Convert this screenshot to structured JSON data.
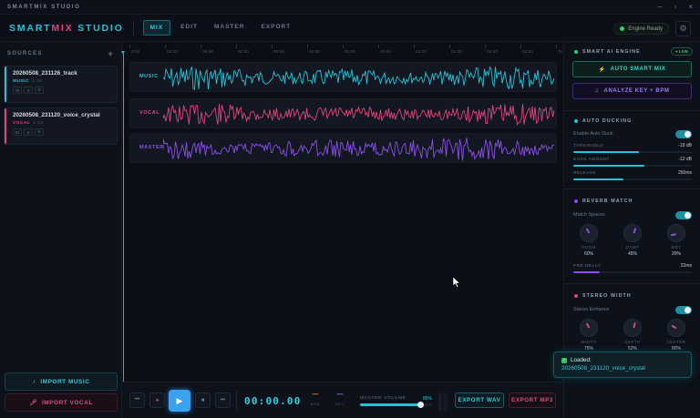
{
  "titlebar": {
    "title": "SMARTMIX STUDIO",
    "min": "–",
    "max": "▫",
    "close": "×"
  },
  "header": {
    "logo_a": "SMART",
    "logo_b": "MIX",
    "logo_c": " STUDIO",
    "tabs": [
      {
        "label": "MIX",
        "active": true
      },
      {
        "label": "EDIT"
      },
      {
        "label": "MASTER"
      },
      {
        "label": "EXPORT"
      }
    ],
    "engine_status": "Engine Ready",
    "settings_icon": "gear-icon"
  },
  "sources": {
    "title": "SOURCES",
    "add": "+",
    "items": [
      {
        "name": "20260508_231126_track",
        "type": "MUSIC",
        "duration": "1:16",
        "color": "#22c5d6",
        "buttons": [
          "M",
          "S",
          "⊘"
        ]
      },
      {
        "name": "20260508_231120_voice_crystal",
        "type": "VOCAL",
        "duration": "1:16",
        "color": "#e0447f",
        "buttons": [
          "M",
          "S",
          "⊘"
        ]
      }
    ],
    "import_music": "IMPORT MUSIC",
    "import_vocal": "IMPORT VOCAL"
  },
  "timeline": {
    "ruler": [
      "0:00",
      "00:10",
      "00:20",
      "00:30",
      "00:40",
      "00:50",
      "01:00",
      "01:10",
      "01:20",
      "01:30",
      "01:40",
      "01:50",
      "01:5"
    ],
    "lanes": [
      {
        "label": "MUSIC",
        "color": "#22c5d6"
      },
      {
        "label": "VOCAL",
        "color": "#e0447f"
      },
      {
        "label": "MASTER",
        "color": "#8a4fe6"
      }
    ]
  },
  "transport": {
    "timecode": "00:00.00",
    "bpm_value": "—",
    "bpm_label": "BPM",
    "key_value": "—",
    "key_label": "KEY",
    "master_volume_label": "MASTER VOLUME",
    "master_volume_pct": "85%",
    "master_volume": 0.85,
    "export_wav": "EXPORT WAV",
    "export_mp3": "EXPORT MP3"
  },
  "ai_engine": {
    "title": "SMART AI ENGINE",
    "live": "● LIVE",
    "auto_button": "AUTO SMART MIX",
    "analyze_button": "ANALYZE KEY + BPM"
  },
  "ducking": {
    "title": "AUTO DUCKING",
    "enable_label": "Enable Auto Duck",
    "enabled": true,
    "threshold_label": "THRESHOLD",
    "threshold_value": "-18 dB",
    "threshold_level": 0.55,
    "amount_label": "DUCK AMOUNT",
    "amount_value": "-12 dB",
    "amount_level": 0.6,
    "release_label": "RELEASE",
    "release_value": "250ms",
    "release_level": 0.42
  },
  "reverb": {
    "title": "REVERB MATCH",
    "match_label": "Match Spaces",
    "enabled": true,
    "knobs": [
      {
        "label": "ROOM",
        "value": "60%"
      },
      {
        "label": "DAMP",
        "value": "45%"
      },
      {
        "label": "WET",
        "value": "20%"
      }
    ],
    "predelay_label": "PRE-DELAY",
    "predelay_value": "22ms",
    "predelay_level": 0.22
  },
  "stereo": {
    "title": "STEREO WIDTH",
    "enhance_label": "Stereo Enhance",
    "enabled": true,
    "knobs": [
      {
        "label": "WIDTH",
        "value": "75%"
      },
      {
        "label": "DEPTH",
        "value": "52%"
      },
      {
        "label": "CENTER",
        "value": "80%"
      }
    ]
  },
  "toast": {
    "title": "Loaded:",
    "file": "20260508_231120_voice_crystal"
  }
}
